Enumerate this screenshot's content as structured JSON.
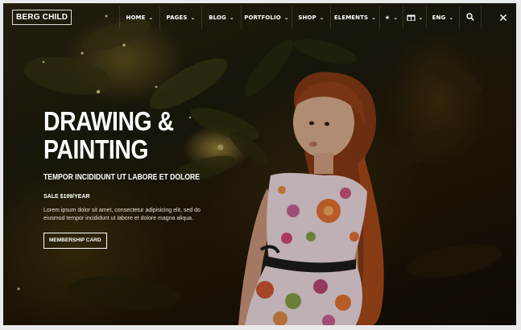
{
  "brand": {
    "logo_text": "BERG CHILD"
  },
  "nav": {
    "items": [
      {
        "label": "HOME",
        "has_dropdown": true
      },
      {
        "label": "PAGES",
        "has_dropdown": true
      },
      {
        "label": "BLOG",
        "has_dropdown": true
      },
      {
        "label": "PORTFOLIO",
        "has_dropdown": true
      },
      {
        "label": "SHOP",
        "has_dropdown": true
      },
      {
        "label": "ELEMENTS",
        "has_dropdown": true
      }
    ],
    "icons": [
      "star-icon",
      "gift-icon"
    ],
    "language": {
      "label": "ENG",
      "has_dropdown": true
    },
    "search_icon": "search-icon",
    "close_icon": "close-icon"
  },
  "hero": {
    "title_lines": [
      "DRAWING &",
      "PAINTING"
    ],
    "subtitle": "TEMPOR INCIDIDUNT UT LABORE ET DOLORE",
    "price": "SALE $199/YEAR",
    "body": "Lorem ipsum dolor sit amet, consectetur adipisicing elit, sed do eiusmod tempor incididunt ut labore et dolore magna aliqua.",
    "cta_label": "MEMBERSHIP CARD"
  },
  "colors": {
    "text": "#ffffff",
    "background_dark": "#1c1a0c",
    "highlight": "#e9c95a"
  }
}
